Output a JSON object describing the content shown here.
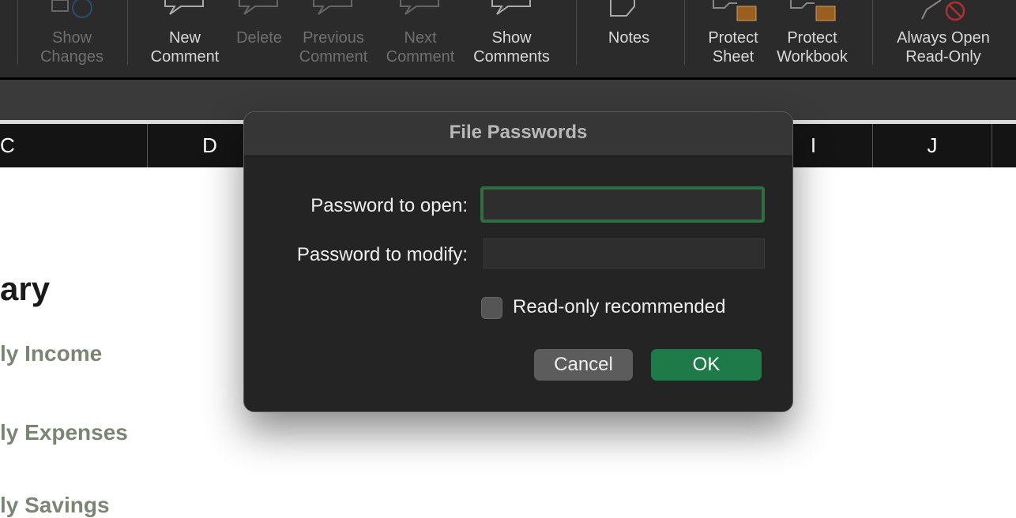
{
  "ribbon": {
    "show_changes": "Show Changes",
    "new_comment": "New Comment",
    "delete": "Delete",
    "previous_comment": "Previous Comment",
    "next_comment": "Next Comment",
    "show_comments": "Show Comments",
    "notes": "Notes",
    "protect_sheet": "Protect Sheet",
    "protect_workbook": "Protect Workbook",
    "always_open_read_only": "Always Open Read-Only"
  },
  "columns": [
    "C",
    "D",
    "I",
    "J"
  ],
  "sheet": {
    "heading": "ary",
    "rows": [
      "ly Income",
      "ly Expenses",
      "ly Savings"
    ]
  },
  "dialog": {
    "title": "File Passwords",
    "password_open_label": "Password to open:",
    "password_open_value": "",
    "password_modify_label": "Password to modify:",
    "password_modify_value": "",
    "read_only_label": "Read-only recommended",
    "read_only_checked": false,
    "cancel": "Cancel",
    "ok": "OK"
  },
  "colors": {
    "accent": "#1e7a48",
    "focus_ring": "#2f6e3f",
    "lock": "#9a5f1e"
  }
}
